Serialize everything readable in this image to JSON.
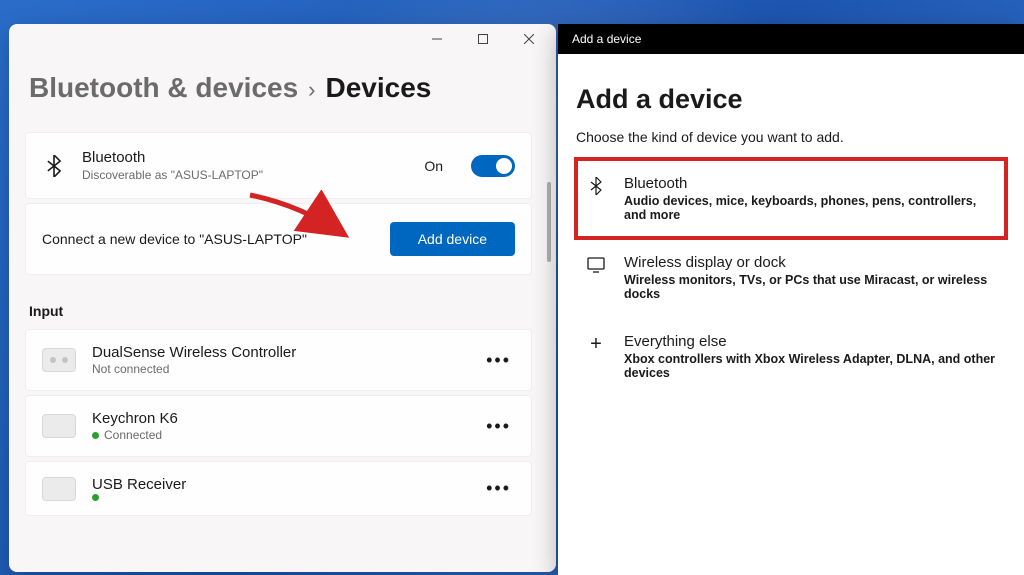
{
  "settings": {
    "breadcrumb": {
      "parent": "Bluetooth & devices",
      "separator": "›",
      "current": "Devices"
    },
    "bluetooth": {
      "title": "Bluetooth",
      "subtitle": "Discoverable as \"ASUS-LAPTOP\"",
      "status": "On"
    },
    "connect": {
      "text": "Connect a new device to \"ASUS-LAPTOP\"",
      "button": "Add device"
    },
    "section_label": "Input",
    "devices": [
      {
        "name": "DualSense Wireless Controller",
        "status": "Not connected",
        "connected": false,
        "icon": "controller"
      },
      {
        "name": "Keychron K6",
        "status": "Connected",
        "connected": true,
        "icon": "keyboard"
      },
      {
        "name": "USB Receiver",
        "status": "",
        "connected": true,
        "icon": "keyboard"
      }
    ]
  },
  "dialog": {
    "titlebar": "Add a device",
    "heading": "Add a device",
    "subheading": "Choose the kind of device you want to add.",
    "options": [
      {
        "title": "Bluetooth",
        "desc": "Audio devices, mice, keyboards, phones, pens, controllers, and more",
        "icon": "bluetooth",
        "highlighted": true
      },
      {
        "title": "Wireless display or dock",
        "desc": "Wireless monitors, TVs, or PCs that use Miracast, or wireless docks",
        "icon": "display",
        "highlighted": false
      },
      {
        "title": "Everything else",
        "desc": "Xbox controllers with Xbox Wireless Adapter, DLNA, and other devices",
        "icon": "plus",
        "highlighted": false
      }
    ]
  }
}
